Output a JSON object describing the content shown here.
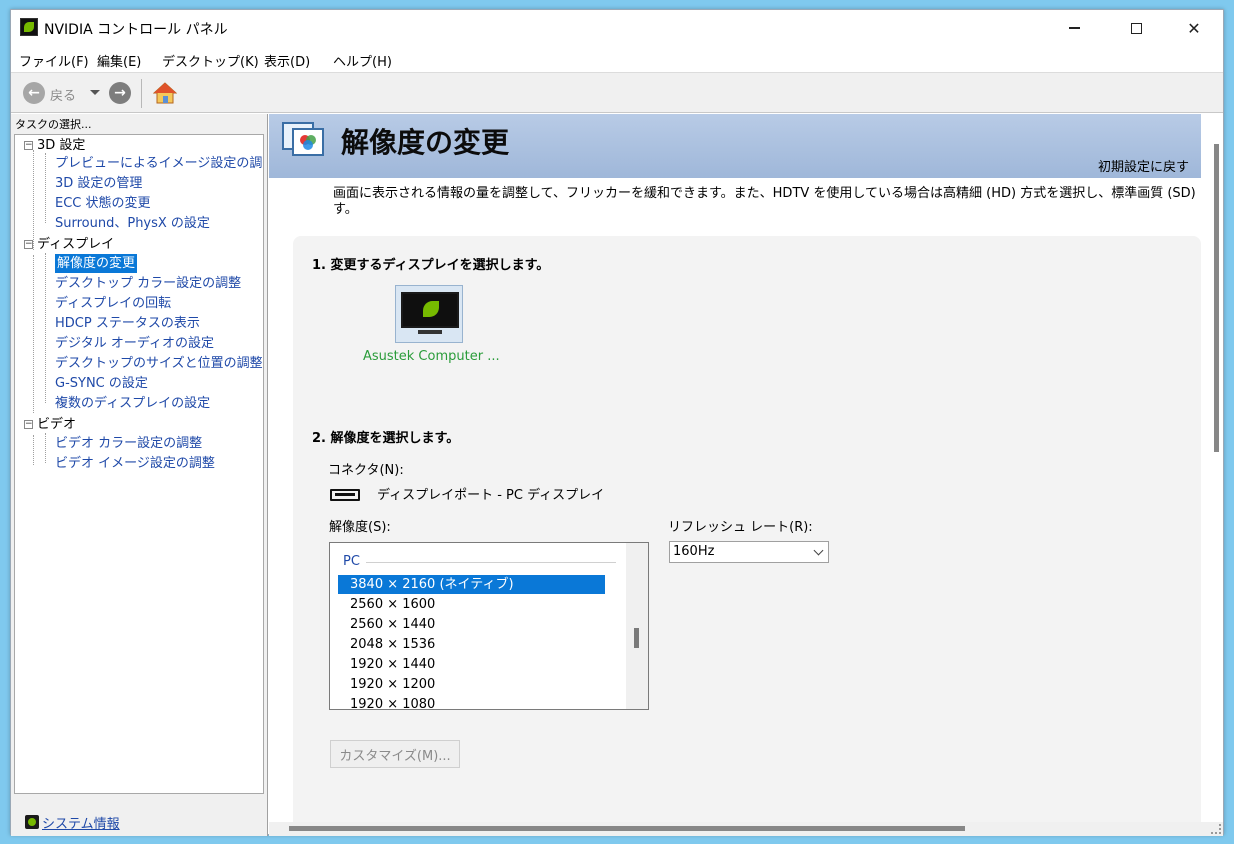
{
  "window": {
    "title": "NVIDIA コントロール パネル"
  },
  "menu": {
    "items": [
      "ファイル(F)",
      "編集(E)",
      "デスクトップ(K)",
      "表示(D)",
      "ヘルプ(H)"
    ]
  },
  "toolbar": {
    "back_label": "戻る"
  },
  "left_pane": {
    "task_label": "タスクの選択...",
    "tree": [
      {
        "label": "3D 設定",
        "children": [
          "プレビューによるイメージ設定の調整",
          "3D 設定の管理",
          "ECC 状態の変更",
          "Surround、PhysX の設定"
        ]
      },
      {
        "label": "ディスプレイ",
        "children": [
          "解像度の変更",
          "デスクトップ カラー設定の調整",
          "ディスプレイの回転",
          "HDCP ステータスの表示",
          "デジタル オーディオの設定",
          "デスクトップのサイズと位置の調整",
          "G-SYNC の設定",
          "複数のディスプレイの設定"
        ]
      },
      {
        "label": "ビデオ",
        "children": [
          "ビデオ カラー設定の調整",
          "ビデオ イメージ設定の調整"
        ]
      }
    ],
    "selected_item": "解像度の変更",
    "system_info_link": "システム情報"
  },
  "main": {
    "page_title": "解像度の変更",
    "restore_defaults": "初期設定に戻す",
    "description": "画面に表示される情報の量を調整して、フリッカーを緩和できます。また、HDTV を使用している場合は高精細 (HD) 方式を選択し、標準画質 (SD) す。",
    "step1": "1. 変更するディスプレイを選択します。",
    "display_name": "Asustek Computer ...",
    "step2": "2. 解像度を選択します。",
    "connector_label": "コネクタ(N):",
    "connector_value": "ディスプレイポート - PC ディスプレイ",
    "resolution_label": "解像度(S):",
    "resolution_group": "PC",
    "resolutions": [
      "3840 × 2160 (ネイティブ)",
      "2560 × 1600",
      "2560 × 1440",
      "2048 × 1536",
      "1920 × 1440",
      "1920 × 1200",
      "1920 × 1080"
    ],
    "selected_resolution": "3840 × 2160 (ネイティブ)",
    "refresh_label": "リフレッシュ レート(R):",
    "refresh_value": "160Hz",
    "customize_button": "カスタマイズ(M)..."
  },
  "colors": {
    "accent_blue": "#0a78d7",
    "link_blue": "#1f49a8",
    "nvidia_green": "#76b900",
    "header_band": "#a9bfdf"
  },
  "icons": {
    "app": "nvidia-logo-icon",
    "back": "back-arrow-icon",
    "forward": "forward-arrow-icon",
    "home": "home-icon",
    "header": "display-settings-icon",
    "monitor": "monitor-icon",
    "connector": "displayport-connector-icon",
    "system_info": "system-info-icon"
  }
}
